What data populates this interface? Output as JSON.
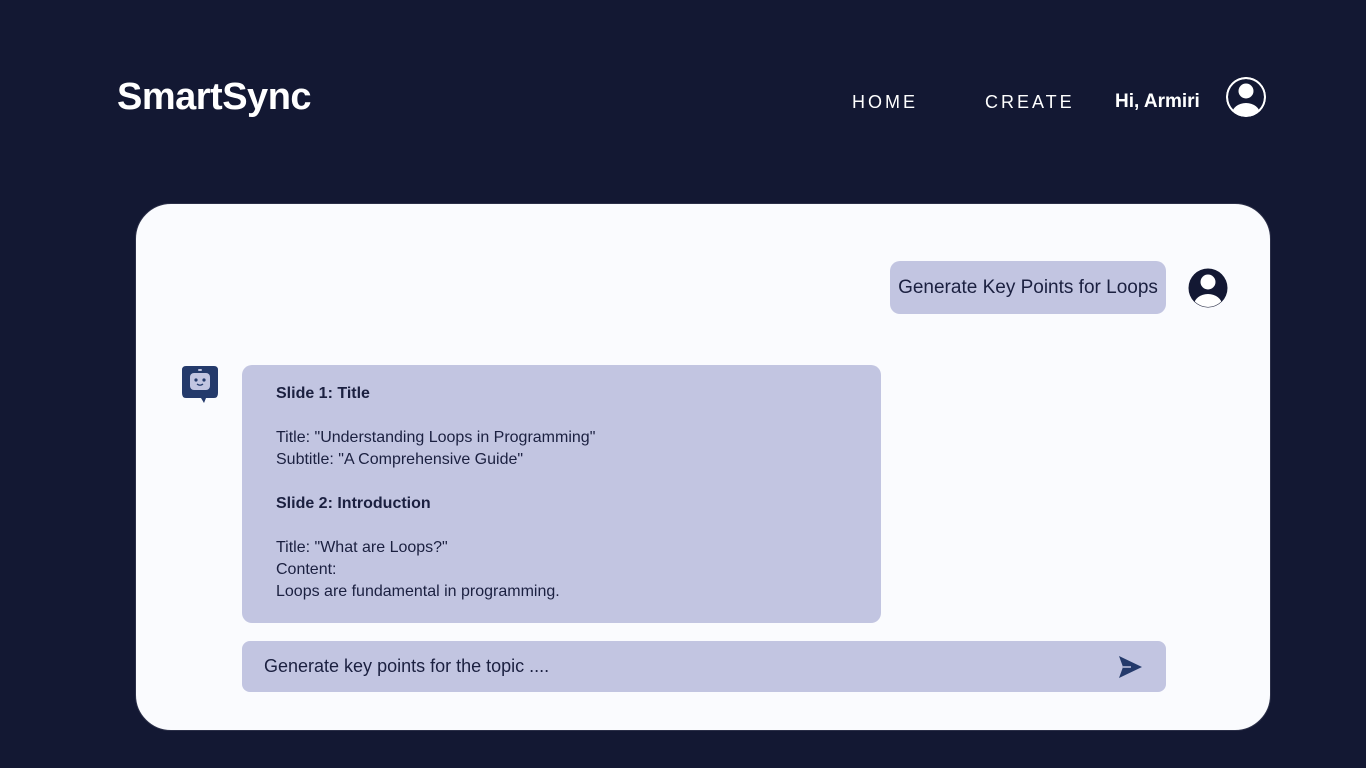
{
  "header": {
    "brand": "SmartSync",
    "nav": [
      {
        "label": "HOME"
      },
      {
        "label": "CREATE"
      }
    ],
    "greeting": "Hi, Armiri"
  },
  "chat": {
    "user_message": "Generate Key Points for Loops",
    "bot_message": {
      "lines": [
        "Slide 1: Title",
        "",
        "Title: \"Understanding Loops in Programming\"",
        "Subtitle: \"A Comprehensive Guide\"",
        "",
        "Slide 2: Introduction",
        "",
        "Title: \"What are Loops?\"",
        "Content:",
        "Loops are fundamental in programming."
      ]
    },
    "input": {
      "placeholder": "Generate key points for the topic ....",
      "value": ""
    }
  },
  "icons": {
    "header_avatar": "user-avatar-icon",
    "user_avatar": "user-avatar-icon",
    "bot_avatar": "robot-chat-icon",
    "send": "send-icon"
  },
  "colors": {
    "background": "#131833",
    "panel": "#fafbfe",
    "bubble": "#c2c5e1",
    "text": "#1b2040",
    "accent": "#243a6b"
  }
}
